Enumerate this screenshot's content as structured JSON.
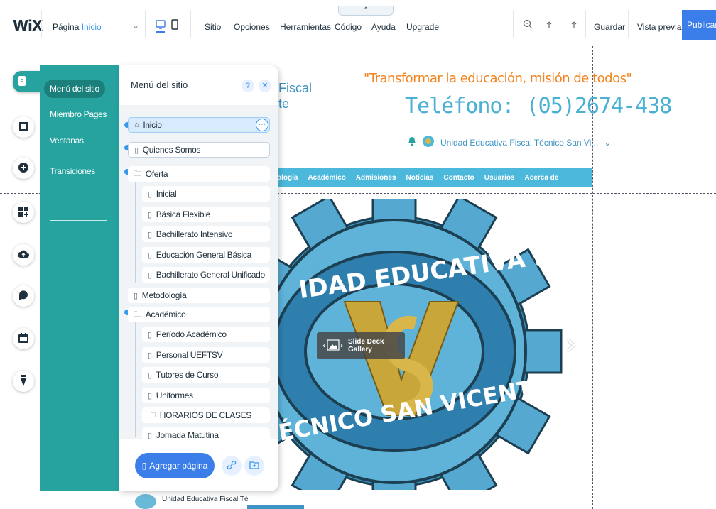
{
  "topbar": {
    "logo": "WiX",
    "page_prefix": "Página",
    "page_current": "Inicio",
    "menus": [
      "Sitio",
      "Opciones",
      "Herramientas",
      "Código",
      "Ayuda",
      "Upgrade"
    ],
    "save": "Guardar",
    "preview": "Vista previa",
    "publish": "Publicar",
    "pull_tab": "^"
  },
  "site": {
    "quote": "\"Transformar la educación, misión de todos\"",
    "phone": "Teléfono: (05)2674-438",
    "title_line1": "Fiscal",
    "title_line2": "te",
    "unit_name": "Unidad Educativa Fiscal Técnico San Vi...",
    "nav": [
      "ología",
      "Académico",
      "Admisiones",
      "Noticias",
      "Contacto",
      "Usuarios",
      "Acerca de"
    ],
    "gear_top_text": "IDAD EDUCATIVA FISCAL",
    "gear_bottom_text": "ÉCNICO SAN VICENTE",
    "gallery_label": "Slide Deck Gallery",
    "footer_text": "Unidad Educativa Fiscal Té"
  },
  "panel_left": {
    "items": [
      "Menú del sitio",
      "Miembro Pages",
      "Ventanas",
      "Transiciones"
    ],
    "selected": 0
  },
  "panel_pages": {
    "title": "Menú del sitio",
    "help": "?",
    "close": "✕",
    "more": "···",
    "pages": [
      {
        "label": "Inicio",
        "icon": "home-icon",
        "level": 0,
        "dot": true,
        "selected": true
      },
      {
        "label": "Quienes Somos",
        "icon": "page-icon",
        "level": 0,
        "dot": true
      },
      {
        "label": "Oferta",
        "icon": "folder-icon",
        "level": 0,
        "dot": true
      },
      {
        "label": "Inicial",
        "icon": "page-icon",
        "level": 1
      },
      {
        "label": "Básica Flexible",
        "icon": "page-icon",
        "level": 1
      },
      {
        "label": "Bachillerato Intensivo",
        "icon": "page-icon",
        "level": 1
      },
      {
        "label": "Educación General Básica",
        "icon": "page-icon",
        "level": 1
      },
      {
        "label": "Bachillerato General Unificado",
        "icon": "page-icon",
        "level": 1
      },
      {
        "label": "Metodología",
        "icon": "page-icon",
        "level": 0
      },
      {
        "label": "Académico",
        "icon": "folder-icon",
        "level": 0,
        "dot": true
      },
      {
        "label": "Período Académico",
        "icon": "page-icon",
        "level": 1
      },
      {
        "label": "Personal UEFTSV",
        "icon": "page-icon",
        "level": 1
      },
      {
        "label": "Tutores de Curso",
        "icon": "page-icon",
        "level": 1
      },
      {
        "label": "Uniformes",
        "icon": "page-icon",
        "level": 1
      },
      {
        "label": "HORARIOS DE CLASES",
        "icon": "folder-icon",
        "level": 1
      },
      {
        "label": "Jornada Matutina",
        "icon": "page-icon",
        "level": 1
      }
    ],
    "add_page": "Agregar página"
  },
  "colors": {
    "accent": "#3b7de9",
    "teal": "#27a39f",
    "site_blue": "#4cb8dc",
    "orange": "#f0831e"
  }
}
